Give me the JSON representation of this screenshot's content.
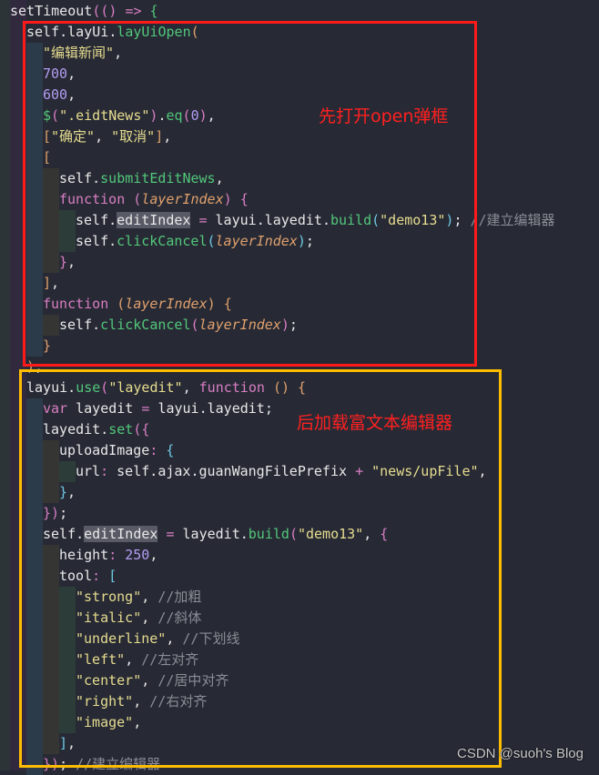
{
  "code": {
    "lines": [
      {
        "indent": [],
        "tokens": [
          [
            "id",
            "setTimeout"
          ],
          [
            "br2",
            "("
          ],
          [
            "br2",
            "("
          ],
          [
            "br2",
            ")"
          ],
          [
            "pun",
            " "
          ],
          [
            "op",
            "=>"
          ],
          [
            "pun",
            " "
          ],
          [
            "br4",
            "{"
          ]
        ]
      },
      {
        "indent": [
          "a"
        ],
        "tokens": [
          [
            "id",
            "self"
          ],
          [
            "pun",
            "."
          ],
          [
            "id",
            "layUi"
          ],
          [
            "pun",
            "."
          ],
          [
            "fn",
            "layUiOpen"
          ],
          [
            "br1",
            "("
          ]
        ]
      },
      {
        "indent": [
          "a",
          "a"
        ],
        "tokens": [
          [
            "str",
            "\"编辑新闻\""
          ],
          [
            "pun",
            ","
          ]
        ]
      },
      {
        "indent": [
          "a",
          "a"
        ],
        "tokens": [
          [
            "num",
            "700"
          ],
          [
            "pun",
            ","
          ]
        ]
      },
      {
        "indent": [
          "a",
          "a"
        ],
        "tokens": [
          [
            "num",
            "600"
          ],
          [
            "pun",
            ","
          ]
        ]
      },
      {
        "indent": [
          "a",
          "a"
        ],
        "tokens": [
          [
            "fn",
            "$"
          ],
          [
            "br2",
            "("
          ],
          [
            "str",
            "\".eidtNews\""
          ],
          [
            "br2",
            ")"
          ],
          [
            "pun",
            "."
          ],
          [
            "fn",
            "eq"
          ],
          [
            "br2",
            "("
          ],
          [
            "num",
            "0"
          ],
          [
            "br2",
            ")"
          ],
          [
            "pun",
            ","
          ]
        ]
      },
      {
        "indent": [
          "a",
          "a"
        ],
        "tokens": [
          [
            "br1",
            "["
          ],
          [
            "str",
            "\"确定\""
          ],
          [
            "pun",
            ", "
          ],
          [
            "str",
            "\"取消\""
          ],
          [
            "br1",
            "]"
          ],
          [
            "pun",
            ","
          ]
        ]
      },
      {
        "indent": [
          "a",
          "a"
        ],
        "tokens": [
          [
            "br1",
            "["
          ]
        ]
      },
      {
        "indent": [
          "a",
          "a",
          "b"
        ],
        "tokens": [
          [
            "id",
            "self"
          ],
          [
            "pun",
            "."
          ],
          [
            "fn",
            "submitEditNews"
          ],
          [
            "pun",
            ","
          ]
        ]
      },
      {
        "indent": [
          "a",
          "a",
          "b"
        ],
        "tokens": [
          [
            "kw",
            "function"
          ],
          [
            "pun",
            " "
          ],
          [
            "br2",
            "("
          ],
          [
            "param",
            "layerIndex"
          ],
          [
            "br2",
            ")"
          ],
          [
            "pun",
            " "
          ],
          [
            "br2",
            "{"
          ]
        ]
      },
      {
        "indent": [
          "a",
          "a",
          "b",
          "c"
        ],
        "tokens": [
          [
            "id",
            "self"
          ],
          [
            "pun",
            "."
          ],
          [
            "hl",
            "editIndex"
          ],
          [
            "pun",
            " "
          ],
          [
            "op",
            "="
          ],
          [
            "pun",
            " "
          ],
          [
            "id",
            "layui"
          ],
          [
            "pun",
            "."
          ],
          [
            "id",
            "layedit"
          ],
          [
            "pun",
            "."
          ],
          [
            "fn",
            "build"
          ],
          [
            "br3",
            "("
          ],
          [
            "str",
            "\"demo13\""
          ],
          [
            "br3",
            ")"
          ],
          [
            "pun",
            "; "
          ],
          [
            "cmt",
            "//建立编辑器"
          ]
        ]
      },
      {
        "indent": [
          "a",
          "a",
          "b",
          "c"
        ],
        "tokens": [
          [
            "id",
            "self"
          ],
          [
            "pun",
            "."
          ],
          [
            "fn",
            "clickCancel"
          ],
          [
            "br3",
            "("
          ],
          [
            "param",
            "layerIndex"
          ],
          [
            "br3",
            ")"
          ],
          [
            "pun",
            ";"
          ]
        ]
      },
      {
        "indent": [
          "a",
          "a",
          "b"
        ],
        "tokens": [
          [
            "br2",
            "}"
          ],
          [
            "pun",
            ","
          ]
        ]
      },
      {
        "indent": [
          "a",
          "a"
        ],
        "tokens": [
          [
            "br1",
            "]"
          ],
          [
            "pun",
            ","
          ]
        ]
      },
      {
        "indent": [
          "a",
          "a"
        ],
        "tokens": [
          [
            "kw",
            "function"
          ],
          [
            "pun",
            " "
          ],
          [
            "br1",
            "("
          ],
          [
            "param",
            "layerIndex"
          ],
          [
            "br1",
            ")"
          ],
          [
            "pun",
            " "
          ],
          [
            "br1",
            "{"
          ]
        ]
      },
      {
        "indent": [
          "a",
          "a",
          "b"
        ],
        "tokens": [
          [
            "id",
            "self"
          ],
          [
            "pun",
            "."
          ],
          [
            "fn",
            "clickCancel"
          ],
          [
            "br2",
            "("
          ],
          [
            "param",
            "layerIndex"
          ],
          [
            "br2",
            ")"
          ],
          [
            "pun",
            ";"
          ]
        ]
      },
      {
        "indent": [
          "a",
          "a"
        ],
        "tokens": [
          [
            "br1",
            "}"
          ]
        ]
      },
      {
        "indent": [
          "a"
        ],
        "tokens": [
          [
            "br1",
            ")"
          ],
          [
            "pun",
            ";"
          ]
        ]
      },
      {
        "indent": [
          "a"
        ],
        "tokens": [
          [
            "id",
            "layui"
          ],
          [
            "pun",
            "."
          ],
          [
            "fn",
            "use"
          ],
          [
            "br2",
            "("
          ],
          [
            "str",
            "\"layedit\""
          ],
          [
            "pun",
            ", "
          ],
          [
            "kw",
            "function"
          ],
          [
            "pun",
            " "
          ],
          [
            "br1",
            "("
          ],
          [
            "br1",
            ")"
          ],
          [
            "pun",
            " "
          ],
          [
            "br1",
            "{"
          ]
        ]
      },
      {
        "indent": [
          "a",
          "a"
        ],
        "tokens": [
          [
            "kw",
            "var"
          ],
          [
            "pun",
            " "
          ],
          [
            "id",
            "layedit"
          ],
          [
            "pun",
            " "
          ],
          [
            "op",
            "="
          ],
          [
            "pun",
            " "
          ],
          [
            "id",
            "layui"
          ],
          [
            "pun",
            "."
          ],
          [
            "id",
            "layedit"
          ],
          [
            "pun",
            ";"
          ]
        ]
      },
      {
        "indent": [
          "a",
          "a"
        ],
        "tokens": [
          [
            "id",
            "layedit"
          ],
          [
            "pun",
            "."
          ],
          [
            "fn",
            "set"
          ],
          [
            "br2",
            "("
          ],
          [
            "br2",
            "{"
          ]
        ]
      },
      {
        "indent": [
          "a",
          "a",
          "b"
        ],
        "tokens": [
          [
            "prop",
            "uploadImage"
          ],
          [
            "op",
            ":"
          ],
          [
            "pun",
            " "
          ],
          [
            "br3",
            "{"
          ]
        ]
      },
      {
        "indent": [
          "a",
          "a",
          "b",
          "c"
        ],
        "tokens": [
          [
            "prop",
            "url"
          ],
          [
            "op",
            ":"
          ],
          [
            "pun",
            " "
          ],
          [
            "id",
            "self"
          ],
          [
            "pun",
            "."
          ],
          [
            "id",
            "ajax"
          ],
          [
            "pun",
            "."
          ],
          [
            "id",
            "guanWangFilePrefix"
          ],
          [
            "pun",
            " "
          ],
          [
            "op",
            "+"
          ],
          [
            "pun",
            " "
          ],
          [
            "str",
            "\"news/upFile\""
          ],
          [
            "pun",
            ","
          ]
        ]
      },
      {
        "indent": [
          "a",
          "a",
          "b"
        ],
        "tokens": [
          [
            "br3",
            "}"
          ],
          [
            "pun",
            ","
          ]
        ]
      },
      {
        "indent": [
          "a",
          "a"
        ],
        "tokens": [
          [
            "br2",
            "}"
          ],
          [
            "br2",
            ")"
          ],
          [
            "pun",
            ";"
          ]
        ]
      },
      {
        "indent": [
          "a",
          "a"
        ],
        "tokens": [
          [
            "id",
            "self"
          ],
          [
            "pun",
            "."
          ],
          [
            "hl",
            "editIndex"
          ],
          [
            "pun",
            " "
          ],
          [
            "op",
            "="
          ],
          [
            "pun",
            " "
          ],
          [
            "id",
            "layedit"
          ],
          [
            "pun",
            "."
          ],
          [
            "fn",
            "build"
          ],
          [
            "br2",
            "("
          ],
          [
            "str",
            "\"demo13\""
          ],
          [
            "pun",
            ", "
          ],
          [
            "br2",
            "{"
          ]
        ]
      },
      {
        "indent": [
          "a",
          "a",
          "b"
        ],
        "tokens": [
          [
            "prop",
            "height"
          ],
          [
            "op",
            ":"
          ],
          [
            "pun",
            " "
          ],
          [
            "num",
            "250"
          ],
          [
            "pun",
            ","
          ]
        ]
      },
      {
        "indent": [
          "a",
          "a",
          "b"
        ],
        "tokens": [
          [
            "prop",
            "tool"
          ],
          [
            "op",
            ":"
          ],
          [
            "pun",
            " "
          ],
          [
            "br3",
            "["
          ]
        ]
      },
      {
        "indent": [
          "a",
          "a",
          "b",
          "c"
        ],
        "tokens": [
          [
            "str",
            "\"strong\""
          ],
          [
            "pun",
            ", "
          ],
          [
            "cmt",
            "//加粗"
          ]
        ]
      },
      {
        "indent": [
          "a",
          "a",
          "b",
          "c"
        ],
        "tokens": [
          [
            "str",
            "\"italic\""
          ],
          [
            "pun",
            ", "
          ],
          [
            "cmt",
            "//斜体"
          ]
        ]
      },
      {
        "indent": [
          "a",
          "a",
          "b",
          "c"
        ],
        "tokens": [
          [
            "str",
            "\"underline\""
          ],
          [
            "pun",
            ", "
          ],
          [
            "cmt",
            "//下划线"
          ]
        ]
      },
      {
        "indent": [
          "a",
          "a",
          "b",
          "c"
        ],
        "tokens": [
          [
            "str",
            "\"left\""
          ],
          [
            "pun",
            ", "
          ],
          [
            "cmt",
            "//左对齐"
          ]
        ]
      },
      {
        "indent": [
          "a",
          "a",
          "b",
          "c"
        ],
        "tokens": [
          [
            "str",
            "\"center\""
          ],
          [
            "pun",
            ", "
          ],
          [
            "cmt",
            "//居中对齐"
          ]
        ]
      },
      {
        "indent": [
          "a",
          "a",
          "b",
          "c"
        ],
        "tokens": [
          [
            "str",
            "\"right\""
          ],
          [
            "pun",
            ", "
          ],
          [
            "cmt",
            "//右对齐"
          ]
        ]
      },
      {
        "indent": [
          "a",
          "a",
          "b",
          "c"
        ],
        "tokens": [
          [
            "str",
            "\"image\""
          ],
          [
            "pun",
            ","
          ]
        ]
      },
      {
        "indent": [
          "a",
          "a",
          "b"
        ],
        "tokens": [
          [
            "br3",
            "]"
          ],
          [
            "pun",
            ","
          ]
        ]
      },
      {
        "indent": [
          "a",
          "a"
        ],
        "tokens": [
          [
            "br2",
            "}"
          ],
          [
            "br2",
            ")"
          ],
          [
            "pun",
            "; "
          ],
          [
            "cmt",
            "//建立编辑器"
          ]
        ]
      }
    ]
  },
  "annotations": {
    "open_dialog_note": "先打开open弹框",
    "editor_note": "后加载富文本编辑器"
  },
  "highlight_colors": {
    "red_box": "#ff1a1a",
    "yellow_box": "#ffbd00"
  },
  "watermark": "CSDN @suoh's Blog"
}
